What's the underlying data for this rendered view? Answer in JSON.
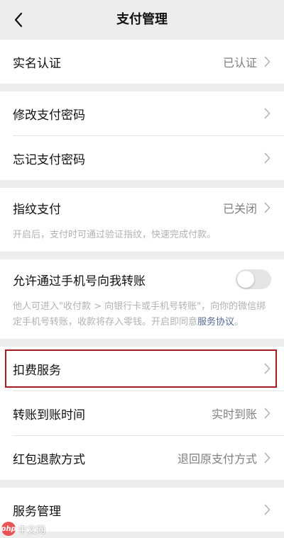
{
  "nav": {
    "title": "支付管理"
  },
  "real_name": {
    "label": "实名认证",
    "value": "已认证"
  },
  "password": {
    "change_label": "修改支付密码",
    "forgot_label": "忘记支付密码"
  },
  "fingerprint": {
    "label": "指纹支付",
    "value": "已关闭",
    "desc": "开启后，支付时可通过验证指纹，快速完成付款。"
  },
  "phone_transfer": {
    "label": "允许通过手机号向我转账",
    "toggle_on": false,
    "desc_prefix": "他人可进入\"收付款 > 向银行卡或手机号转账\"，向你的微信绑定手机号转账，收款将存入零钱。开启即同意",
    "desc_link": "服务协议",
    "desc_suffix": "。"
  },
  "deduction": {
    "label": "扣费服务"
  },
  "transfer_time": {
    "label": "转账到账时间",
    "value": "实时到账"
  },
  "red_packet": {
    "label": "红包退款方式",
    "value": "退回原支付方式"
  },
  "service_mgmt": {
    "label": "服务管理"
  },
  "watermark": {
    "badge": "php",
    "text": "中文网"
  },
  "colors": {
    "background": "#ededed",
    "highlight_border": "#a31d1d",
    "link": "#576b95"
  }
}
